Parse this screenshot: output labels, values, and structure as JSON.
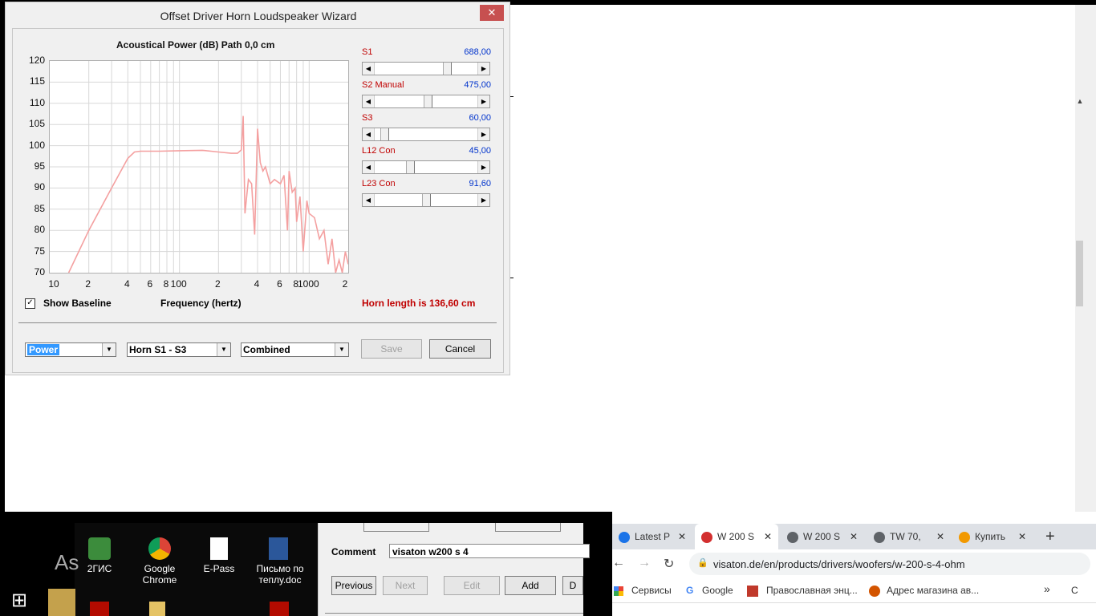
{
  "dialog": {
    "title": "Offset Driver Horn Loudspeaker Wizard",
    "close_glyph": "✕",
    "chart_title": "Acoustical Power (dB)   Path 0,0 cm",
    "x_axis_title": "Frequency (hertz)",
    "baseline_checkbox_glyph": "✓",
    "baseline_label": "Show Baseline",
    "horn_length": "Horn length is 136,60 cm",
    "params": [
      {
        "label": "S1",
        "value": "688,00",
        "pos": 0.64
      },
      {
        "label": "S2  Manual",
        "value": "475,00",
        "pos": 0.44
      },
      {
        "label": "S3",
        "value": "60,00",
        "pos": 0.06
      },
      {
        "label": "L12  Con",
        "value": "45,00",
        "pos": 0.3
      },
      {
        "label": "L23  Con",
        "value": "91,60",
        "pos": 0.46
      }
    ],
    "combos": {
      "view": "Power",
      "section": "Horn S1 - S3",
      "mode": "Combined"
    },
    "buttons": {
      "save": "Save",
      "cancel": "Cancel"
    },
    "slider_arrows": {
      "left": "◀",
      "right": "▶"
    },
    "dropdown_glyph": "▼"
  },
  "chart_data": {
    "type": "line",
    "title": "Acoustical Power (dB)   Path 0,0 cm",
    "xlabel": "Frequency (hertz)",
    "ylabel": "",
    "x_scale": "log",
    "xlim": [
      10,
      2000
    ],
    "ylim": [
      70,
      120
    ],
    "y_ticks": [
      "120",
      "115",
      "110",
      "105",
      "100",
      "95",
      "90",
      "85",
      "80",
      "75",
      "70"
    ],
    "x_ticks": [
      "10",
      "2",
      "4",
      "6",
      "8",
      "100",
      "2",
      "4",
      "6",
      "8",
      "1000",
      "2"
    ],
    "grid": true,
    "line_color": "#f4a0a0",
    "series": [
      {
        "x": [
          14,
          20,
          30,
          40,
          45,
          50,
          70,
          100,
          150,
          200,
          250,
          280,
          300,
          305,
          310,
          320,
          340,
          360,
          380,
          400,
          410,
          420,
          440,
          460,
          500,
          540,
          600,
          640,
          680,
          700,
          740,
          780,
          800,
          850,
          900,
          960,
          1000,
          1100,
          1200,
          1300,
          1400,
          1500,
          1600,
          1700,
          1800,
          1900,
          2000
        ],
        "y": [
          70,
          80,
          90,
          97,
          98.5,
          98.7,
          98.7,
          98.8,
          98.9,
          98.5,
          98.2,
          98.2,
          99,
          103,
          107,
          84,
          92,
          91,
          79,
          104,
          100,
          96,
          94,
          95,
          91,
          92,
          91,
          93,
          80,
          94,
          89,
          90,
          82,
          88,
          75,
          87,
          84,
          83,
          78,
          80,
          72,
          78,
          70,
          73,
          68,
          75,
          72
        ]
      }
    ]
  },
  "background": {
    "scroll_up_glyph": "▲"
  },
  "desktop": {
    "as_text": "As",
    "icons": [
      {
        "label": "2ГИС"
      },
      {
        "label": "Google Chrome"
      },
      {
        "label": "E-Pass"
      },
      {
        "label": "Письмо по теплу.doc"
      }
    ],
    "start_glyph": "⊞",
    "form": {
      "comment_label": "Comment",
      "comment_value": "visaton w200 s 4",
      "previous": "Previous",
      "next": "Next",
      "edit": "Edit",
      "add": "Add",
      "d": "D"
    }
  },
  "chrome": {
    "tabs": [
      {
        "label": "Latest P",
        "color": "#1a73e8",
        "active": false
      },
      {
        "label": "W 200 S",
        "color": "#d32f2f",
        "active": true
      },
      {
        "label": "W 200 S",
        "color": "#5f6368",
        "active": false
      },
      {
        "label": "TW 70,",
        "color": "#5f6368",
        "active": false
      },
      {
        "label": "Купить",
        "color": "#f29900",
        "active": false
      }
    ],
    "tab_close_glyph": "✕",
    "new_tab_glyph": "+",
    "back_glyph": "←",
    "forward_glyph": "→",
    "reload_glyph": "↻",
    "lock_glyph": "🔒",
    "url": "visaton.de/en/products/drivers/woofers/w-200-s-4-ohm",
    "bookmarks": [
      "Сервисы",
      "Google",
      "Православная энц...",
      "Адрес магазина ав..."
    ],
    "bookmarks_more": "»",
    "reading_list": "С"
  }
}
